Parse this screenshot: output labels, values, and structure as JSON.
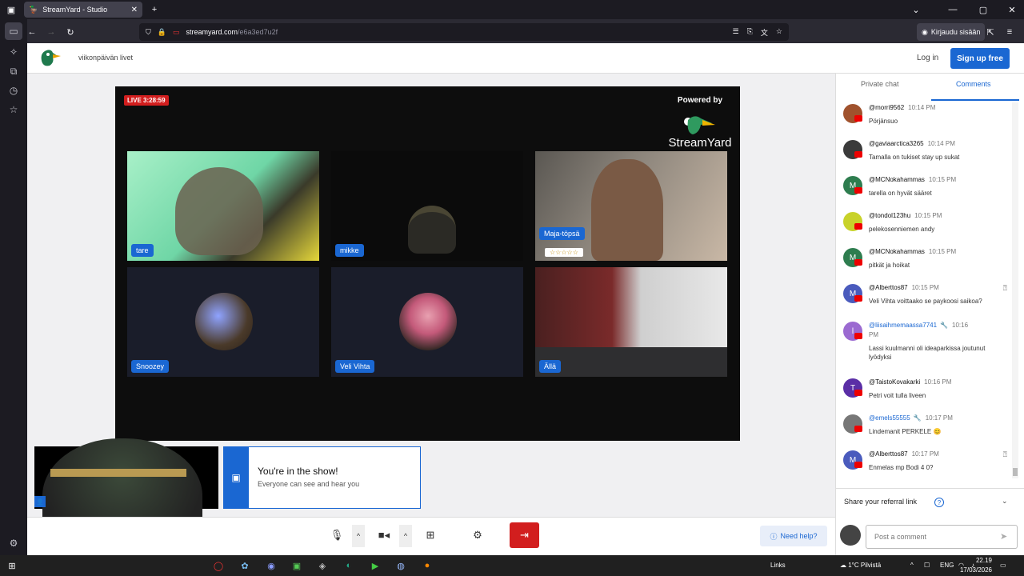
{
  "browser": {
    "tab_title": "StreamYard - Studio",
    "url_host": "streamyard.com",
    "url_path": "/e6a3ed7u2f",
    "account_label": "Kirjaudu sisään"
  },
  "header": {
    "brand_text": "viikonpäivän livet",
    "login_label": "Log in",
    "signup_label": "Sign up free"
  },
  "stage": {
    "live_badge": "LIVE 3:28:59",
    "powered_by": "Powered by",
    "powered_brand": "StreamYard",
    "tiles": [
      {
        "name": "tare"
      },
      {
        "name": "mikke"
      },
      {
        "name": "Maja-töpsä"
      },
      {
        "name": "Snoozey"
      },
      {
        "name": "Veli Vihta"
      },
      {
        "name": "Ällä"
      }
    ],
    "maja_stars": "☆☆☆☆☆"
  },
  "show_banner": {
    "title": "You're in the show!",
    "subtitle": "Everyone can see and hear you"
  },
  "controls": {
    "help_label": "Need help?"
  },
  "chat": {
    "tab_private": "Private chat",
    "tab_comments": "Comments",
    "comments": [
      {
        "user": "@morri9562",
        "time": "10:14 PM",
        "text": "Pörjänsuo",
        "avatar": "",
        "color": "#a0522d"
      },
      {
        "user": "@gaviaarctica3265",
        "time": "10:14 PM",
        "text": "Tamalla on tukiset stay up sukat",
        "avatar": "",
        "color": "#3a3a3a"
      },
      {
        "user": "@MCNokahammas",
        "time": "10:15 PM",
        "text": "tarella on hyvät sääret",
        "avatar": "M",
        "color": "#2e7d4f"
      },
      {
        "user": "@tondol123hu",
        "time": "10:15 PM",
        "text": "pelekosenniemen andy",
        "avatar": "",
        "color": "#c8d22a"
      },
      {
        "user": "@MCNokahammas",
        "time": "10:15 PM",
        "text": "pitkät ja hoikat",
        "avatar": "M",
        "color": "#2e7d4f"
      },
      {
        "user": "@Alberttos87",
        "time": "10:15 PM",
        "text": "Veli Vihta voittaako se paykoosi saikoa?",
        "avatar": "M",
        "color": "#4a5bbd"
      },
      {
        "user": "@liisaihmemaassa7741",
        "time": "10:16",
        "time2": "PM",
        "text": "Lassi kuulmanni oli ideaparkissa joutunut lyödyksi",
        "avatar": "l",
        "color": "#9b6ad1"
      },
      {
        "user": "@TaistoKovakarki",
        "time": "10:16 PM",
        "text": "Petri voit tulla liveen",
        "avatar": "T",
        "color": "#5a2ea6"
      },
      {
        "user": "@emels55555",
        "time": "10:17 PM",
        "text": "Lindemanit PERKELE 😊",
        "avatar": "",
        "color": "#777"
      },
      {
        "user": "@Alberttos87",
        "time": "10:17 PM",
        "text": "Enmelas mp Bodi 4 0?",
        "avatar": "M",
        "color": "#4a5bbd"
      }
    ],
    "referral_label": "Share your referral link",
    "post_placeholder": "Post a comment"
  },
  "taskbar": {
    "links_label": "Links",
    "weather": "1°C Pilvistä",
    "lang": "ENG",
    "time": "22.19",
    "date": "17/03/2026"
  }
}
